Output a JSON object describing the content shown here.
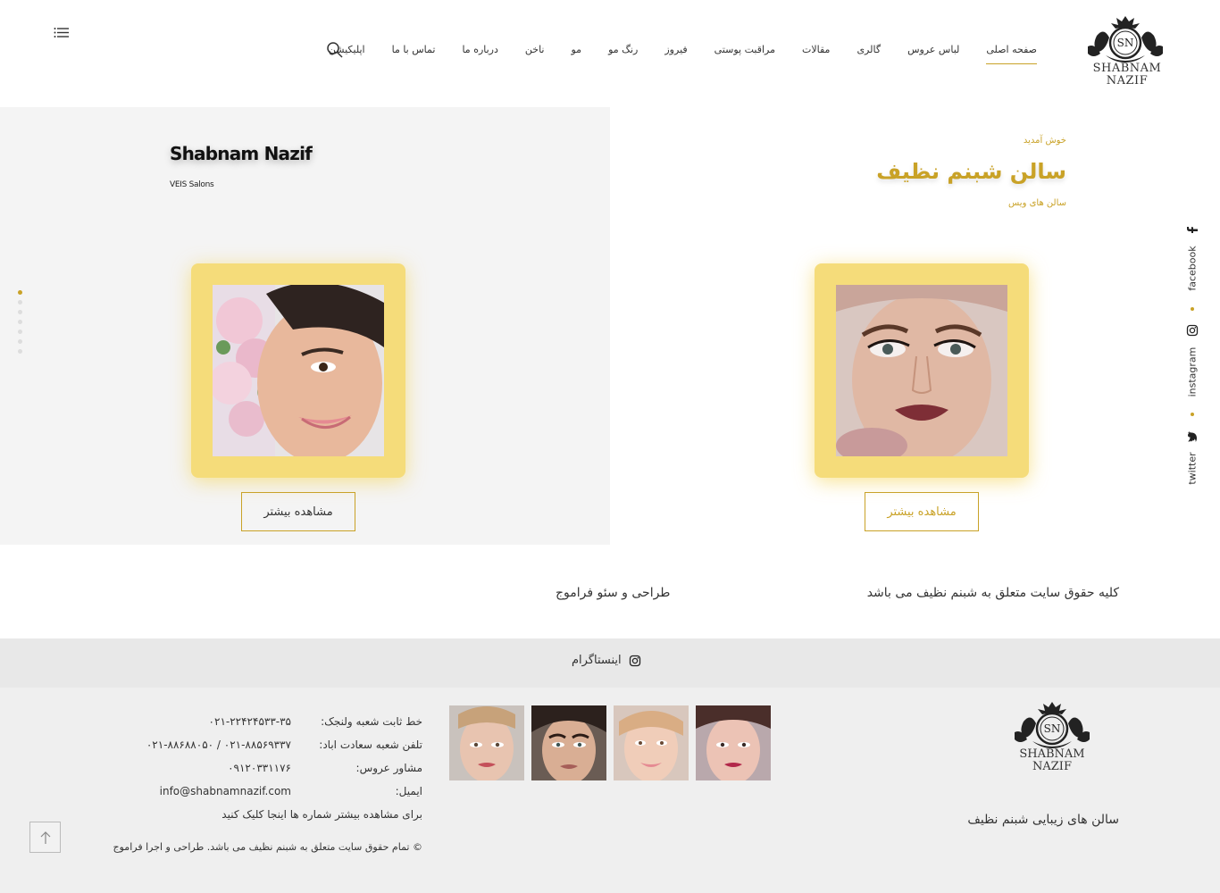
{
  "header": {
    "brand_line1": "SHABNAM",
    "brand_line2": "NAZIF",
    "nav": [
      "صفحه اصلی",
      "لباس عروس",
      "گالری",
      "مقالات",
      "مراقبت پوستی",
      "فیروز",
      "رنگ مو",
      "مو",
      "ناخن",
      "درباره ما",
      "تماس با ما",
      "اپلیکیشن"
    ],
    "active_nav_index": 0,
    "search_icon": "search-icon",
    "menu_icon": "hamburger-menu-icon"
  },
  "slider": {
    "left": {
      "title": "Shabnam Nazif",
      "subtitle": "VEIS Salons",
      "button": "مشاهده بیشتر"
    },
    "right": {
      "welcome": "خوش آمدید",
      "title": "سالن شبنم نظیف",
      "subtitle": "سالن های ویس",
      "button": "مشاهده بیشتر"
    },
    "dots_count": 7,
    "active_dot": 0,
    "accent_color": "#c9a227",
    "frame_color": "#f5dc7a"
  },
  "social": {
    "items": [
      {
        "label": "facebook",
        "icon": "facebook-icon"
      },
      {
        "label": "instagram",
        "icon": "instagram-icon"
      },
      {
        "label": "twitter",
        "icon": "twitter-icon"
      }
    ]
  },
  "rights": {
    "text": "کلیه حقوق سایت متعلق به شبنم نظیف می باشد",
    "design": "طراحی و سئو فراموج"
  },
  "instagram_bar": {
    "label": "اینستاگرام"
  },
  "footer": {
    "brand_line1": "SHABNAM",
    "brand_line2": "NAZIF",
    "tagline": "سالن های زیبایی شبنم نظیف",
    "contact": [
      {
        "label": "خط ثابت شعبه ولنجک:",
        "value": "۰۲۱-۲۲۴۲۴۵۳۳-۳۵"
      },
      {
        "label": "تلفن شعبه سعادت اباد:",
        "value": "۰۲۱-۸۸۶۸۸۰۵۰  /  ۰۲۱-۸۸۵۶۹۳۳۷"
      },
      {
        "label": "مشاور عروس:",
        "value": "۰۹۱۲۰۳۳۱۱۷۶"
      },
      {
        "label": "ایمیل:",
        "value": "info@shabnamnazif.com"
      }
    ],
    "more_numbers": "برای مشاهده بیشتر شماره ها اینجا کلیک کنید",
    "copyright": "© تمام حقوق سایت متعلق به شبنم نظیف می باشد. طراحی و اجرا فراموج"
  }
}
